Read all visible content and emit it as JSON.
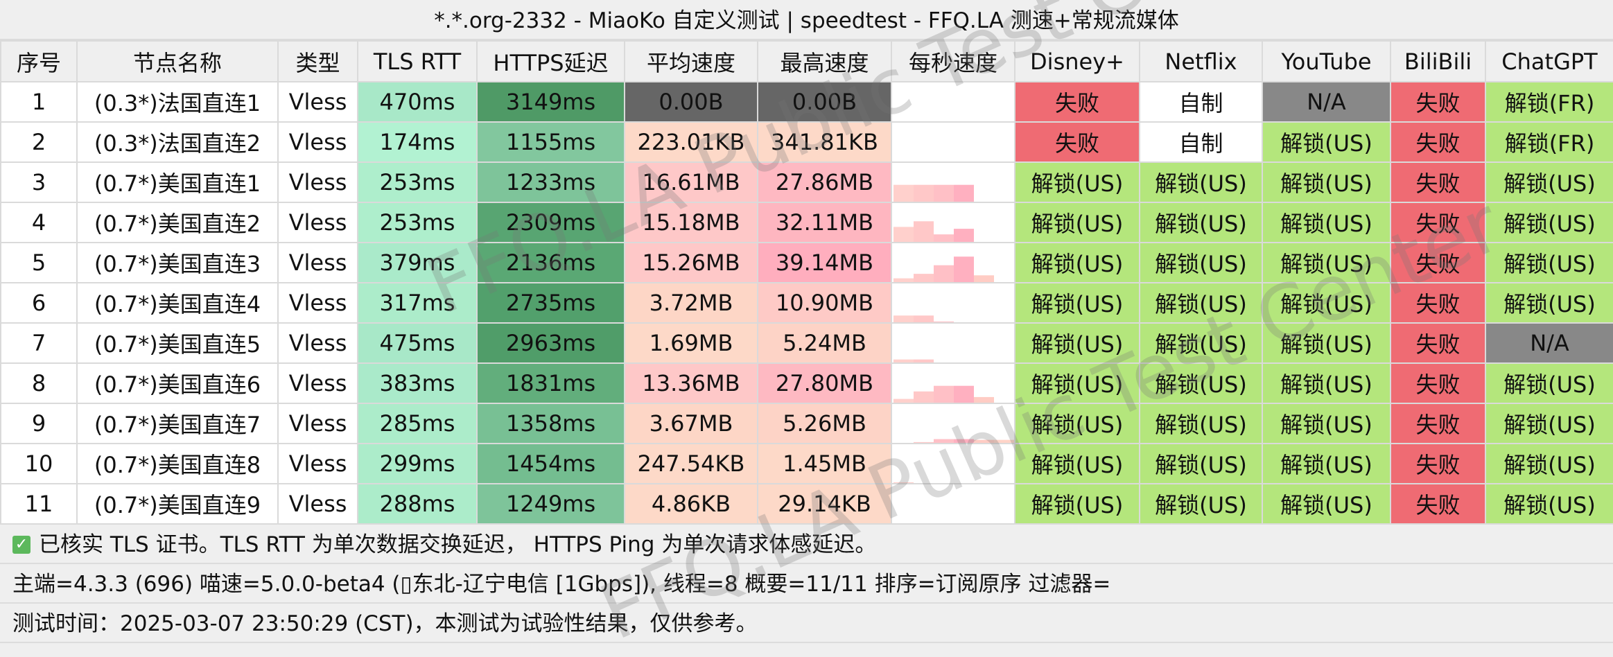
{
  "title": "*.*.org-2332 - MiaoKo 自定义测试 | speedtest - FFQ.LA 测速+常规流媒体",
  "columns": [
    "序号",
    "节点名称",
    "类型",
    "TLS RTT",
    "HTTPS延迟",
    "平均速度",
    "最高速度",
    "每秒速度",
    "Disney+",
    "Netflix",
    "YouTube",
    "BiliBili",
    "ChatGPT"
  ],
  "colors": {
    "tls_rtt_light": "#aef0d0",
    "https_dark": "#4f9e68",
    "https_mid": "#6cbb8a",
    "https_light": "#86cc9f",
    "speed_zero": "#666666",
    "speed_low": "#fdd9c8",
    "speed_mid": "#fec8c8",
    "speed_high": "#ffb0c0",
    "unlock_green": "#b4e67c",
    "fail_red": "#ef6b73",
    "na_gray": "#888888",
    "self_made_white": "#ffffff"
  },
  "rows": [
    {
      "idx": "1",
      "name": "(0.3*)法国直连1",
      "type": "Vless",
      "tls": "470ms",
      "https": "3149ms",
      "avg": "0.00B",
      "max": "0.00B",
      "spark": [],
      "disney": "失败",
      "netflix": "自制",
      "youtube": "N/A",
      "bili": "失败",
      "chatgpt": "解锁(FR)",
      "tls_bg": "#a8e8c8",
      "https_bg": "#4f9a66",
      "avg_bg": "#666666",
      "max_bg": "#666666"
    },
    {
      "idx": "2",
      "name": "(0.3*)法国直连2",
      "type": "Vless",
      "tls": "174ms",
      "https": "1155ms",
      "avg": "223.01KB",
      "max": "341.81KB",
      "spark": [],
      "disney": "失败",
      "netflix": "自制",
      "youtube": "解锁(US)",
      "bili": "失败",
      "chatgpt": "解锁(FR)",
      "tls_bg": "#b2f2d2",
      "https_bg": "#82c79e",
      "avg_bg": "#fdd9c8",
      "max_bg": "#fdd9c8"
    },
    {
      "idx": "3",
      "name": "(0.7*)美国直连1",
      "type": "Vless",
      "tls": "253ms",
      "https": "1233ms",
      "avg": "16.61MB",
      "max": "27.86MB",
      "spark": [
        0.45,
        0.45,
        0.45,
        0.45,
        0
      ],
      "disney": "解锁(US)",
      "netflix": "解锁(US)",
      "youtube": "解锁(US)",
      "bili": "失败",
      "chatgpt": "解锁(US)",
      "tls_bg": "#aeeecc",
      "https_bg": "#7ec49a",
      "avg_bg": "#fec8c8",
      "max_bg": "#feb9c2"
    },
    {
      "idx": "4",
      "name": "(0.7*)美国直连2",
      "type": "Vless",
      "tls": "253ms",
      "https": "2309ms",
      "avg": "15.18MB",
      "max": "32.11MB",
      "spark": [
        0.4,
        0.55,
        0.2,
        0.35,
        0
      ],
      "disney": "解锁(US)",
      "netflix": "解锁(US)",
      "youtube": "解锁(US)",
      "bili": "失败",
      "chatgpt": "解锁(US)",
      "tls_bg": "#aeeecc",
      "https_bg": "#58a572",
      "avg_bg": "#fec8c8",
      "max_bg": "#feb6c0"
    },
    {
      "idx": "5",
      "name": "(0.7*)美国直连3",
      "type": "Vless",
      "tls": "379ms",
      "https": "2136ms",
      "avg": "15.26MB",
      "max": "39.14MB",
      "spark": [
        0.1,
        0.22,
        0.45,
        0.68,
        0.18
      ],
      "disney": "解锁(US)",
      "netflix": "解锁(US)",
      "youtube": "解锁(US)",
      "bili": "失败",
      "chatgpt": "解锁(US)",
      "tls_bg": "#aaeaca",
      "https_bg": "#5aa874",
      "avg_bg": "#fec8c8",
      "max_bg": "#ffaebe"
    },
    {
      "idx": "6",
      "name": "(0.7*)美国直连4",
      "type": "Vless",
      "tls": "317ms",
      "https": "2735ms",
      "avg": "3.72MB",
      "max": "10.90MB",
      "spark": [
        0.18,
        0.18,
        0.02,
        0,
        0
      ],
      "disney": "解锁(US)",
      "netflix": "解锁(US)",
      "youtube": "解锁(US)",
      "bili": "失败",
      "chatgpt": "解锁(US)",
      "tls_bg": "#acecca",
      "https_bg": "#52a06c",
      "avg_bg": "#fdd6c6",
      "max_bg": "#fecac6"
    },
    {
      "idx": "7",
      "name": "(0.7*)美国直连5",
      "type": "Vless",
      "tls": "475ms",
      "https": "2963ms",
      "avg": "1.69MB",
      "max": "5.24MB",
      "spark": [
        0.08,
        0.08,
        0,
        0,
        0
      ],
      "disney": "解锁(US)",
      "netflix": "解锁(US)",
      "youtube": "解锁(US)",
      "bili": "失败",
      "chatgpt": "N/A",
      "tls_bg": "#a8e8c8",
      "https_bg": "#509d69",
      "avg_bg": "#fdd9c8",
      "max_bg": "#fdd3c6"
    },
    {
      "idx": "8",
      "name": "(0.7*)美国直连6",
      "type": "Vless",
      "tls": "383ms",
      "https": "1831ms",
      "avg": "13.36MB",
      "max": "27.80MB",
      "spark": [
        0.1,
        0.3,
        0.45,
        0.45,
        0.15
      ],
      "disney": "解锁(US)",
      "netflix": "解锁(US)",
      "youtube": "解锁(US)",
      "bili": "失败",
      "chatgpt": "解锁(US)",
      "tls_bg": "#aaeaca",
      "https_bg": "#62ae7c",
      "avg_bg": "#fec8c8",
      "max_bg": "#feb9c2"
    },
    {
      "idx": "9",
      "name": "(0.7*)美国直连7",
      "type": "Vless",
      "tls": "285ms",
      "https": "1358ms",
      "avg": "3.67MB",
      "max": "5.26MB",
      "spark": [
        0,
        0.02,
        0.1,
        0.1,
        0.08,
        0.08
      ],
      "disney": "解锁(US)",
      "netflix": "解锁(US)",
      "youtube": "解锁(US)",
      "bili": "失败",
      "chatgpt": "解锁(US)",
      "tls_bg": "#acecca",
      "https_bg": "#78c094",
      "avg_bg": "#fdd6c6",
      "max_bg": "#fdd3c6"
    },
    {
      "idx": "10",
      "name": "(0.7*)美国直连8",
      "type": "Vless",
      "tls": "299ms",
      "https": "1454ms",
      "avg": "247.54KB",
      "max": "1.45MB",
      "spark": [
        0.02,
        0,
        0,
        0,
        0
      ],
      "disney": "解锁(US)",
      "netflix": "解锁(US)",
      "youtube": "解锁(US)",
      "bili": "失败",
      "chatgpt": "解锁(US)",
      "tls_bg": "#acecca",
      "https_bg": "#74bd90",
      "avg_bg": "#fdd9c8",
      "max_bg": "#fdd9c8"
    },
    {
      "idx": "11",
      "name": "(0.7*)美国直连9",
      "type": "Vless",
      "tls": "288ms",
      "https": "1249ms",
      "avg": "4.86KB",
      "max": "29.14KB",
      "spark": [],
      "disney": "解锁(US)",
      "netflix": "解锁(US)",
      "youtube": "解锁(US)",
      "bili": "失败",
      "chatgpt": "解锁(US)",
      "tls_bg": "#acecca",
      "https_bg": "#7ec49a",
      "avg_bg": "#fdd9c8",
      "max_bg": "#fdd9c8"
    }
  ],
  "footer": {
    "check_icon": "✓",
    "line1": "已核实 TLS 证书。TLS RTT 为单次数据交换延迟， HTTPS Ping 为单次请求体感延迟。",
    "line2": "主端=4.3.3 (696) 喵速=5.0.0-beta4 (▯东北-辽宁电信 [1Gbps]), 线程=8 概要=11/11 排序=订阅原序 过滤器=",
    "line3": "测试时间：2025-03-07 23:50:29 (CST)，本测试为试验性结果，仅供参考。"
  },
  "watermarks": [
    "FFQ.LA Public Test Center",
    "FFQ.LA Public Test Center"
  ]
}
